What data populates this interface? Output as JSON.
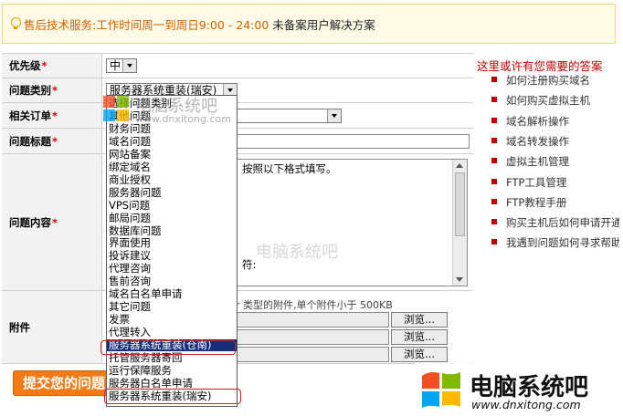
{
  "notice": {
    "prefix": "售后技术服务:",
    "hours": "工作时间周一到周日9:00 - 24:00",
    "link": "未备案用户解决方案"
  },
  "form": {
    "priority": {
      "label": "优先级",
      "required": "*",
      "value": "中"
    },
    "category": {
      "label": "问题类别",
      "required": "*",
      "value": "服务器系统重装(瑞安)"
    },
    "order": {
      "label": "相关订单",
      "required": "*"
    },
    "title": {
      "label": "问题标题",
      "required": "*"
    },
    "content": {
      "label": "问题内容",
      "required": "*",
      "line1": "按照以下格式填写。",
      "line2": "符:"
    },
    "attachment": {
      "label": "附件",
      "hint": "r 类型的附件,单个附件小于 500KB",
      "browse": [
        "浏览...",
        "浏览...",
        "浏览..."
      ]
    },
    "submit": "提交您的问题"
  },
  "dropdown": {
    "options": [
      "选择问题类别",
      "其他问题",
      "财务问题",
      "域名问题",
      "网站备案",
      "绑定域名",
      "商业授权",
      "服务器问题",
      "VPS问题",
      "邮局问题",
      "数据库问题",
      "界面使用",
      "投诉建议",
      "代理咨询",
      "售前咨询",
      "域名白名单申请",
      "其它问题",
      "发票",
      "代理转入",
      "服务器系统重装(仓南)",
      "托管服务器寄回",
      "运行保障服务",
      "服务器白名单申请",
      "服务器系统重装(瑞安)"
    ],
    "selected_index": 19
  },
  "help": {
    "title": "这里或许有您需要的答案",
    "items": [
      "如何注册购买域名",
      "如何购买虚拟主机",
      "域名解析操作",
      "域名转发操作",
      "虚拟主机管理",
      "FTP工具管理",
      "FTP教程手册",
      "购买主机后如何申请开通",
      "我遇到问题如何寻求帮助"
    ]
  },
  "watermark": {
    "name": "电脑系统吧",
    "url": "www.dnxitong.com"
  },
  "colors": {
    "accent": "#f37a16",
    "required": "#d00000",
    "highlight": "#1a2d7a",
    "help_title": "#c00000"
  }
}
